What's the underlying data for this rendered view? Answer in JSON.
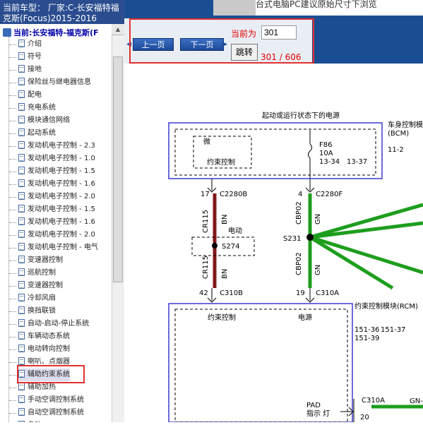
{
  "vehicle_header": "当前车型： 厂家:C-长安福特福克斯(Focus)2015-2016",
  "tree": {
    "root": "当前:长安福特-福克斯(F",
    "items": [
      "介绍",
      "符号",
      "接地",
      "保险丝与继电器信息",
      "配电",
      "充电系统",
      "模块通信网络",
      "起动系统",
      "发动机电子控制 - 2.3",
      "发动机电子控制 - 1.0",
      "发动机电子控制 - 1.5",
      "发动机电子控制 - 1.6",
      "发动机电子控制 - 2.0",
      "发动机电子控制 - 1.5",
      "发动机电子控制 - 1.6",
      "发动机电子控制 - 2.0",
      "发动机电子控制 - 电气",
      "变速器控制",
      "巡航控制",
      "变速器控制",
      "冷却风扇",
      "换挡联锁",
      "自动-启动-停止系统",
      "车辆动态系统",
      "电动转向控制",
      "喇叭、点烟器",
      "辅助约束系统",
      "辅助加热",
      "手动空调控制系统",
      "自动空调控制系统",
      "自动..."
    ],
    "selected_index": 26
  },
  "banner": {
    "text": "台式电脑PC建议原始尺寸下浏览"
  },
  "nav": {
    "prev_label": "上一页",
    "next_label": "下一页",
    "current_label": "当前为",
    "current_value": "301",
    "jump_label": "跳转",
    "page_count": "301 / 606"
  },
  "diagram": {
    "power_title": "起动或运行状态下的电源",
    "bcm_label": "车身控制模块",
    "bcm_abbr": "(BCM)",
    "bcm_code": "11-2",
    "micro_label": "微",
    "restraint_ctrl": "约束控制",
    "fuse_name": "F86",
    "fuse_rating": "10A",
    "fuse_ref1": "13-34",
    "fuse_ref2": "13-37",
    "pin_17": "17",
    "conn_c2280b": "C2280B",
    "pin_4": "4",
    "conn_c2280f": "C2280F",
    "wire_cr115_a": "CR115",
    "wire_bn_a": "BN",
    "wire_cbp02_a": "CBP02",
    "wire_gn_a": "GN",
    "motor_label": "电动",
    "splice_s274": "S274",
    "splice_s231": "S231",
    "wire_cr115_b": "CR115",
    "wire_bn_b": "BN",
    "wire_cbp02_b": "CBP02",
    "wire_gn_b": "GN",
    "pin_42": "42",
    "conn_c310b": "C310B",
    "pin_19": "19",
    "conn_c310a": "C310A",
    "rcm_label": "约束控制模块(RCM)",
    "rcm_restraint": "约束控制",
    "rcm_power": "电源",
    "ref_151_36": "151-36",
    "ref_151_37": "151-37",
    "ref_151_39": "151-39",
    "pad_label": "PAD",
    "pad_indicator": "指示 灯",
    "conn_c310a_b": "C310A",
    "pin_20": "20",
    "wire_gn_c": "GN-"
  },
  "colors": {
    "header_blue": "#1a4e93",
    "wire_green": "#1e9e1e",
    "wire_brown": "#8b1a1a",
    "highlight_red": "#e23030"
  }
}
